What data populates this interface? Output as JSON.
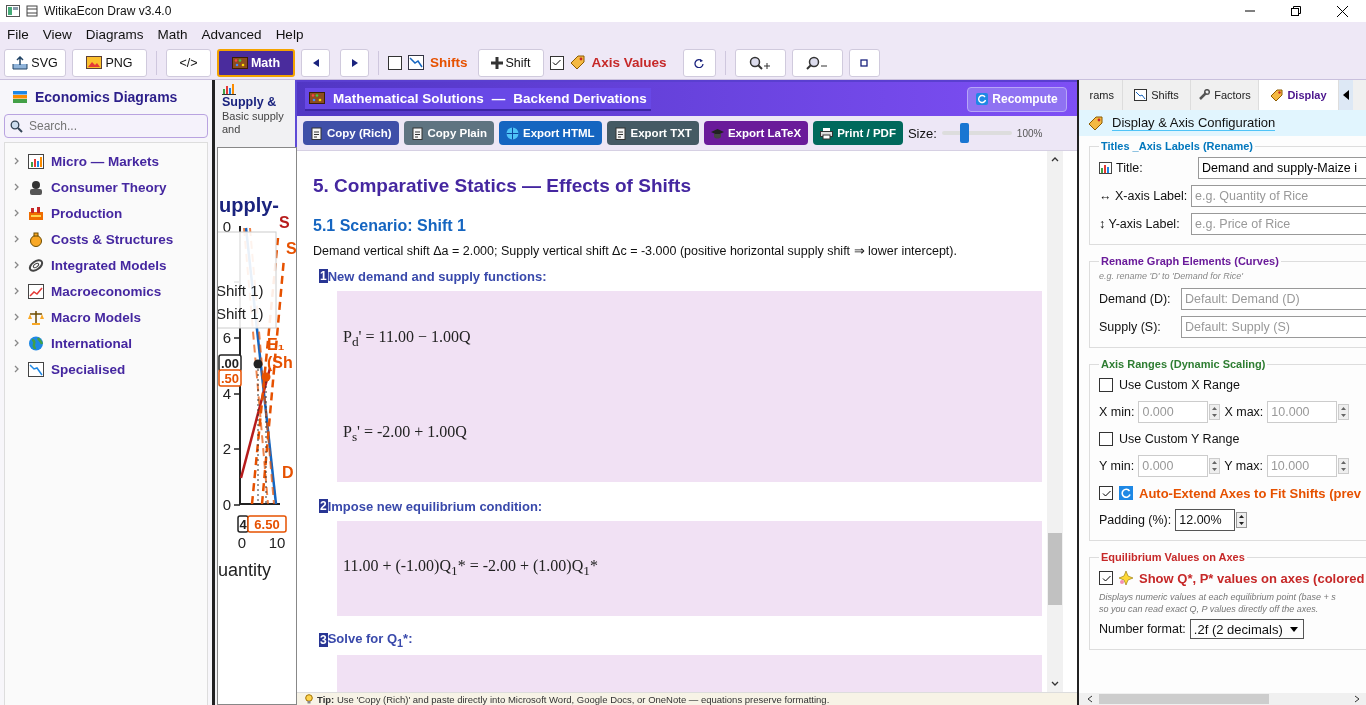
{
  "window": {
    "title": "WitikaEcon Draw  v3.4.0"
  },
  "menu": [
    "File",
    "View",
    "Diagrams",
    "Math",
    "Advanced",
    "Help"
  ],
  "toolbar": {
    "export_buttons": [
      "SVG",
      "PNG"
    ],
    "code_button": "</>",
    "math_button": {
      "label": "Math",
      "active": true
    },
    "shifts_toggle": {
      "label": "Shifts",
      "checked": false
    },
    "add_shift_button": "Shift",
    "axis_values_toggle": {
      "label": "Axis Values",
      "checked": true
    }
  },
  "sidebar": {
    "title": "Economics Diagrams",
    "search_placeholder": "Search...",
    "categories": [
      {
        "label": "Micro — Markets",
        "expanded": false
      },
      {
        "label": "Consumer Theory",
        "expanded": false
      },
      {
        "label": "Production",
        "expanded": false
      },
      {
        "label": "Costs & Structures",
        "expanded": false
      },
      {
        "label": "Integrated Models",
        "expanded": false
      },
      {
        "label": "Macroeconomics",
        "expanded": false
      },
      {
        "label": "Macro Models",
        "expanded": false
      },
      {
        "label": "International",
        "expanded": false
      },
      {
        "label": "Specialised",
        "expanded": false
      }
    ]
  },
  "diagram_card": {
    "title": "Supply &",
    "description": "Basic supply and"
  },
  "preview_chart": {
    "title": "upply-",
    "legend": [
      "Shift 1)",
      "Shift 1)"
    ],
    "y_ticks": [
      "0",
      "6",
      "4",
      "2",
      "0"
    ],
    "x_ticks": [
      "0",
      "10"
    ],
    "x_label": "uantity",
    "curve_labels": [
      {
        "text": "S",
        "color": "#b71c1c"
      },
      {
        "text": "S",
        "color": "#e65100"
      },
      {
        "text": "E₁",
        "color": "#e65100"
      },
      {
        "text": "(Sh",
        "color": "#e65100"
      },
      {
        "text": "D",
        "color": "#e65100"
      }
    ],
    "value_tags": [
      {
        "text": ".00",
        "color": "#222222"
      },
      {
        "text": ".50",
        "color": "#e65100"
      },
      {
        "text": "4",
        "color": "#222222"
      },
      {
        "text": "6.50",
        "color": "#e65100"
      }
    ]
  },
  "solutions": {
    "title": "Mathematical Solutions",
    "separator": "—",
    "subtitle": "Backend Derivations",
    "recompute_button": "Recompute",
    "actions": [
      {
        "label": "Copy (Rich)",
        "color": "#3f4fa8"
      },
      {
        "label": "Copy Plain",
        "color": "#5f7481"
      },
      {
        "label": "Export HTML",
        "color": "#1565c0"
      },
      {
        "label": "Export TXT",
        "color": "#455a64"
      },
      {
        "label": "Export LaTeX",
        "color": "#6a1b9a"
      },
      {
        "label": "Print / PDF",
        "color": "#00695c"
      }
    ],
    "size_label": "Size:",
    "size": {
      "level": 0.3
    },
    "size_reading": "100%",
    "heading": "5. Comparative Statics — Effects of Shifts",
    "scenario": "5.1 Scenario: Shift 1",
    "intro": "Demand vertical shift Δa = 2.000; Supply vertical shift Δc = -3.000 (positive horizontal supply shift ⇒ lower intercept).",
    "steps": [
      {
        "number": "1",
        "title": "New demand and supply functions:",
        "equations": [
          "P$_{d}$' = 11.00 − 1.00Q",
          "P$_{s}$' = -2.00 + 1.00Q"
        ]
      },
      {
        "number": "2",
        "title": "Impose new equilibrium condition:",
        "equations": [
          "11.00 + (-1.00)Q$_{1}$* = -2.00 + (1.00)Q$_{1}$*"
        ]
      },
      {
        "number": "3",
        "title": "Solve for Q$_{1}$*:"
      }
    ],
    "tip": "**Tip:** Use 'Copy (Rich)' and paste directly into Microsoft Word, Google Docs, or OneNote — equations preserve formatting."
  },
  "config": {
    "tabs": [
      {
        "label": "rams",
        "selected": false
      },
      {
        "label": "Shifts",
        "selected": false
      },
      {
        "label": "Factors",
        "selected": false
      },
      {
        "label": "Display",
        "selected": true
      }
    ],
    "title": "Display & Axis Configuration",
    "titles_section": {
      "legend": "Titles _Axis Labels (Rename)",
      "fields": [
        {
          "label": "Title:",
          "value": "Demand and supply-Maize i"
        },
        {
          "label": "↔ X-axis Label:",
          "placeholder": "e.g. Quantity of Rice"
        },
        {
          "label": "↕ Y-axis Label:",
          "placeholder": "e.g. Price of Rice"
        }
      ]
    },
    "curves_section": {
      "legend": "Rename Graph Elements (Curves)",
      "hint": "e.g. rename 'D' to 'Demand for Rice'",
      "fields": [
        {
          "label": "Demand (D):",
          "placeholder": "Default: Demand (D)"
        },
        {
          "label": "Supply (S):",
          "placeholder": "Default: Supply (S)"
        }
      ]
    },
    "ranges_section": {
      "legend": "Axis Ranges (Dynamic Scaling)",
      "custom_x": {
        "label": "Use Custom X Range",
        "checked": false
      },
      "x_range": [
        {
          "label": "X min:",
          "value": "0.000",
          "disabled": true
        },
        {
          "label": "X max:",
          "value": "10.000",
          "disabled": true
        }
      ],
      "custom_y": {
        "label": "Use Custom Y Range",
        "checked": false
      },
      "y_range": [
        {
          "label": "Y min:",
          "value": "0.000",
          "disabled": true
        },
        {
          "label": "Y max:",
          "value": "10.000",
          "disabled": true
        }
      ],
      "auto_extend": {
        "label": "Auto-Extend Axes to Fit Shifts (prev",
        "checked": true
      },
      "padding": {
        "label": "Padding (%):",
        "value": "12.00%"
      }
    },
    "equilibrium_section": {
      "legend": "Equilibrium Values on Axes",
      "show_values": {
        "label": "Show Q*, P* values on axes (colored",
        "checked": true
      },
      "note_lines": [
        "Displays numeric values at each equilibrium point (base + s",
        "so you can read exact Q, P values directly off the axes."
      ],
      "number_format": {
        "label": "Number format:",
        "value": ".2f (2 decimals)"
      }
    }
  }
}
